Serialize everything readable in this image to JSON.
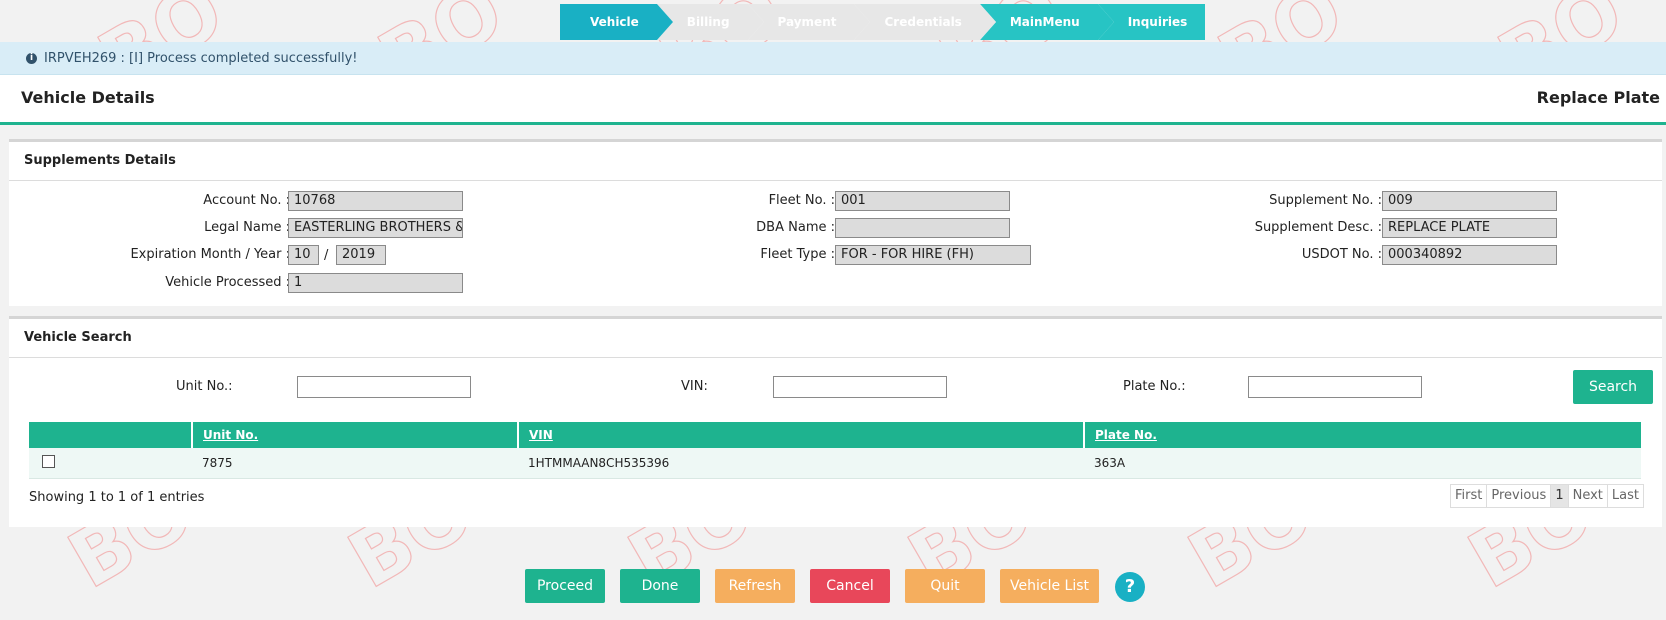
{
  "steps": [
    {
      "label": "Vehicle",
      "state": "active"
    },
    {
      "label": "Billing",
      "state": "disabled"
    },
    {
      "label": "Payment",
      "state": "disabled"
    },
    {
      "label": "Credentials",
      "state": "disabled"
    },
    {
      "label": "MainMenu",
      "state": "next"
    },
    {
      "label": "Inquiries",
      "state": "next"
    }
  ],
  "alert": {
    "message": "IRPVEH269 : [I] Process completed successfully!",
    "icon": "info-icon"
  },
  "title": {
    "left": "Vehicle Details",
    "right": "Replace Plate"
  },
  "supplements": {
    "heading": "Supplements Details",
    "account_label": "Account No. :",
    "account_value": "10768",
    "legal_label": "Legal Name :",
    "legal_value": "EASTERLING BROTHERS & S",
    "exp_label": "Expiration Month / Year :",
    "exp_month": "10",
    "exp_sep": "/",
    "exp_year": "2019",
    "processed_label": "Vehicle Processed :",
    "processed_value": "1",
    "fleet_label": "Fleet No. :",
    "fleet_value": "001",
    "dba_label": "DBA Name :",
    "dba_value": "",
    "fleettype_label": "Fleet Type :",
    "fleettype_value": "FOR - FOR HIRE (FH)",
    "suppno_label": "Supplement No. :",
    "suppno_value": "009",
    "suppdesc_label": "Supplement Desc. :",
    "suppdesc_value": "REPLACE PLATE",
    "usdot_label": "USDOT No. :",
    "usdot_value": "000340892"
  },
  "search": {
    "heading": "Vehicle Search",
    "unit_label": "Unit No.:",
    "unit_value": "",
    "vin_label": "VIN:",
    "vin_value": "",
    "plate_label": "Plate No.:",
    "plate_value": "",
    "button": "Search"
  },
  "table": {
    "columns": [
      "",
      "Unit No.",
      "VIN",
      "Plate No."
    ],
    "rows": [
      {
        "unit": "7875",
        "vin": "1HTMMAAN8CH535396",
        "plate": "363A"
      }
    ],
    "showing": "Showing 1 to 1 of 1 entries",
    "pager": {
      "first": "First",
      "previous": "Previous",
      "current": "1",
      "next": "Next",
      "last": "Last"
    }
  },
  "buttons": {
    "proceed": "Proceed",
    "done": "Done",
    "refresh": "Refresh",
    "cancel": "Cancel",
    "quit": "Quit",
    "vehicle_list": "Vehicle List",
    "help": "?"
  },
  "colors": {
    "primary": "#1eb38f",
    "step_active": "#19b0c4",
    "warning": "#f5ae5e",
    "danger": "#e8475a"
  }
}
